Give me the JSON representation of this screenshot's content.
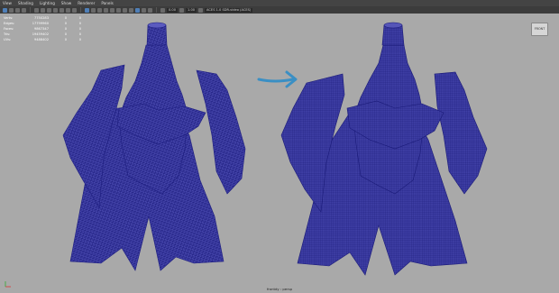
{
  "menu": {
    "items": [
      "View",
      "Shading",
      "Lighting",
      "Show",
      "Renderer",
      "Panels"
    ]
  },
  "toolbar": {
    "field_a": "0.00",
    "field_b": "1.00",
    "colorspace": "ACES 1.0 SDR-video (ACES)"
  },
  "hud": {
    "rows": [
      {
        "label": "Verts:",
        "v1": "7750283",
        "v2": "0",
        "v3": "0"
      },
      {
        "label": "Edges:",
        "v1": "17799960",
        "v2": "0",
        "v3": "0"
      },
      {
        "label": "Faces:",
        "v1": "9867347",
        "v2": "0",
        "v3": "0"
      },
      {
        "label": "Tris:",
        "v1": "19459402",
        "v2": "0",
        "v3": "0"
      },
      {
        "label": "UVs:",
        "v1": "9488402",
        "v2": "0",
        "v3": "0"
      }
    ]
  },
  "viewcube_label": "FRONT",
  "camera_label": "frontdy : persp",
  "colors": {
    "wire": "#2a2a8c",
    "arrow": "#3a8fc4",
    "background": "#a9a9a9"
  }
}
